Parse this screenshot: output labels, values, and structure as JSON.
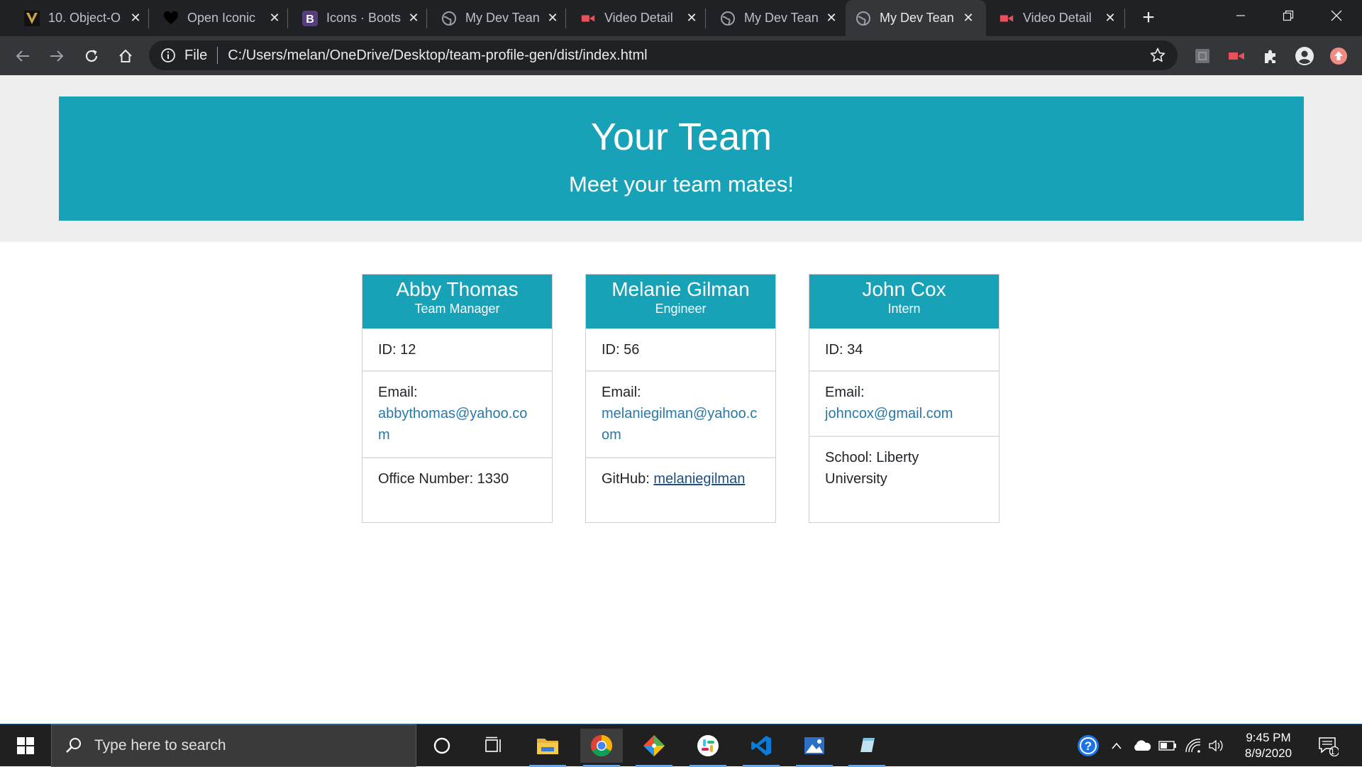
{
  "browser": {
    "tabs": [
      {
        "title": "10. Object-O",
        "favicon": "vanderbilt-v-icon",
        "active": false
      },
      {
        "title": "Open Iconic",
        "favicon": "heart-icon",
        "active": false
      },
      {
        "title": "Icons · Boots",
        "favicon": "bootstrap-b-icon",
        "active": false
      },
      {
        "title": "My Dev Tean",
        "favicon": "globe-icon",
        "active": false
      },
      {
        "title": "Video Detail",
        "favicon": "video-camera-icon",
        "active": false
      },
      {
        "title": "My Dev Tean",
        "favicon": "globe-icon",
        "active": false
      },
      {
        "title": "My Dev Tean",
        "favicon": "globe-icon",
        "active": true
      },
      {
        "title": "Video Detail",
        "favicon": "video-camera-icon",
        "active": false
      }
    ],
    "address": {
      "scheme_label": "File",
      "url": "C:/Users/melan/OneDrive/Desktop/team-profile-gen/dist/index.html"
    }
  },
  "page": {
    "title": "Your Team",
    "subtitle": "Meet your team mates!",
    "accent_color": "#17a2b8",
    "team": [
      {
        "name": "Abby Thomas",
        "role": "Team Manager",
        "id_text": "ID: 12",
        "email_label": "Email:",
        "email": "abbythomas@yahoo.com",
        "extra_label": "Office Number: 1330",
        "extra_link": ""
      },
      {
        "name": "Melanie Gilman",
        "role": "Engineer",
        "id_text": "ID: 56",
        "email_label": "Email:",
        "email": "melaniegilman@yahoo.com",
        "extra_label": "GitHub: ",
        "extra_link": "melaniegilman"
      },
      {
        "name": "John Cox",
        "role": "Intern",
        "id_text": "ID: 34",
        "email_label": "Email:",
        "email": "johncox@gmail.com",
        "extra_label": "School: Liberty University",
        "extra_link": ""
      }
    ]
  },
  "taskbar": {
    "search_placeholder": "Type here to search",
    "time": "9:45 PM",
    "date": "8/9/2020",
    "notification_count": "1"
  }
}
